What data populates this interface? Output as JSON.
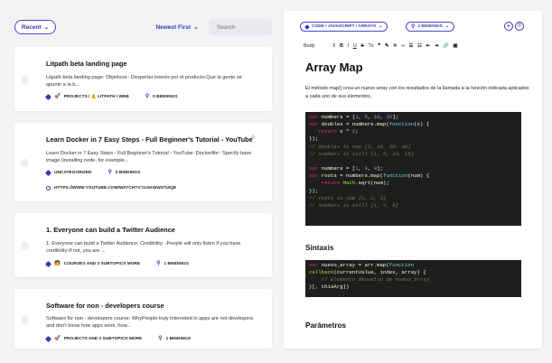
{
  "toolbar": {
    "recent_label": "Recent",
    "newest_label": "Newest First",
    "search_placeholder": "Search"
  },
  "cards": [
    {
      "title": "Litpath beta landing page",
      "desc": "Litpath beta landing page: Objetivos:: Despertar interés por el producto.Que la gente se apunte a la b...",
      "emoji": "🚀",
      "collection": "PROJECTS / ⚠️ LITPATH / WEB",
      "bindings": "0 BINDINGS"
    },
    {
      "title": "Learn Docker in 7 Easy Steps - Full Beginner's Tutorial - YouTube",
      "desc": "Learn Docker in 7 Easy Steps - Full Beginner's Tutorial - YouTube: Dockerfile:: Specify base image (installing node, for example...",
      "collection": "UNCATEGORIZED",
      "bindings": "0 BINDINGS",
      "url": "HTTPS://WWW.YOUTUBE.COM/WATCH?V=GAKWW2TUIQE"
    },
    {
      "title": "1. Everyone can build a Twitter Audience",
      "desc": "1. Everyone can build a Twitter Audience: Credibility: -People will only listen if you have credibility-If not, you are ...",
      "emoji": "🧑",
      "collection": "COURSES AND 3 SUBTOPICS MORE",
      "bindings": "1 BINDINGS"
    },
    {
      "title": "Software for non - developers course",
      "desc": "Software for non - developers course: WhyPeople truly interested in apps are not developers and don't know how apps work, how...",
      "emoji": "🚀",
      "collection": "PROJECTS AND 2 SUBTOPICS MORE",
      "bindings": "1 BINDINGS"
    }
  ],
  "editor": {
    "path_label": "CODE / JAVASCRIPT / ARRAYS",
    "bindings_label": "2 BINDINGS",
    "format_style": "Body",
    "format_buttons": [
      "B",
      "I",
      "U",
      "S",
      "Tx",
      "❞",
      "✎",
      "✕",
      "‹›",
      "☰",
      "☷",
      "⇤",
      "⇥",
      "🔗",
      "▣"
    ],
    "title": "Array Map",
    "paragraph": "El método map() crea un nuevo array con los resultados de la llamada a la función indicada aplicados a cada uno de sus elementos.",
    "section_sintaxis": "Sintaxis",
    "section_parametros": "Parámetros"
  },
  "colors": {
    "accent": "#3b37b5",
    "code_bg": "#1e1f1c",
    "page_bg": "#f3f3f6"
  }
}
